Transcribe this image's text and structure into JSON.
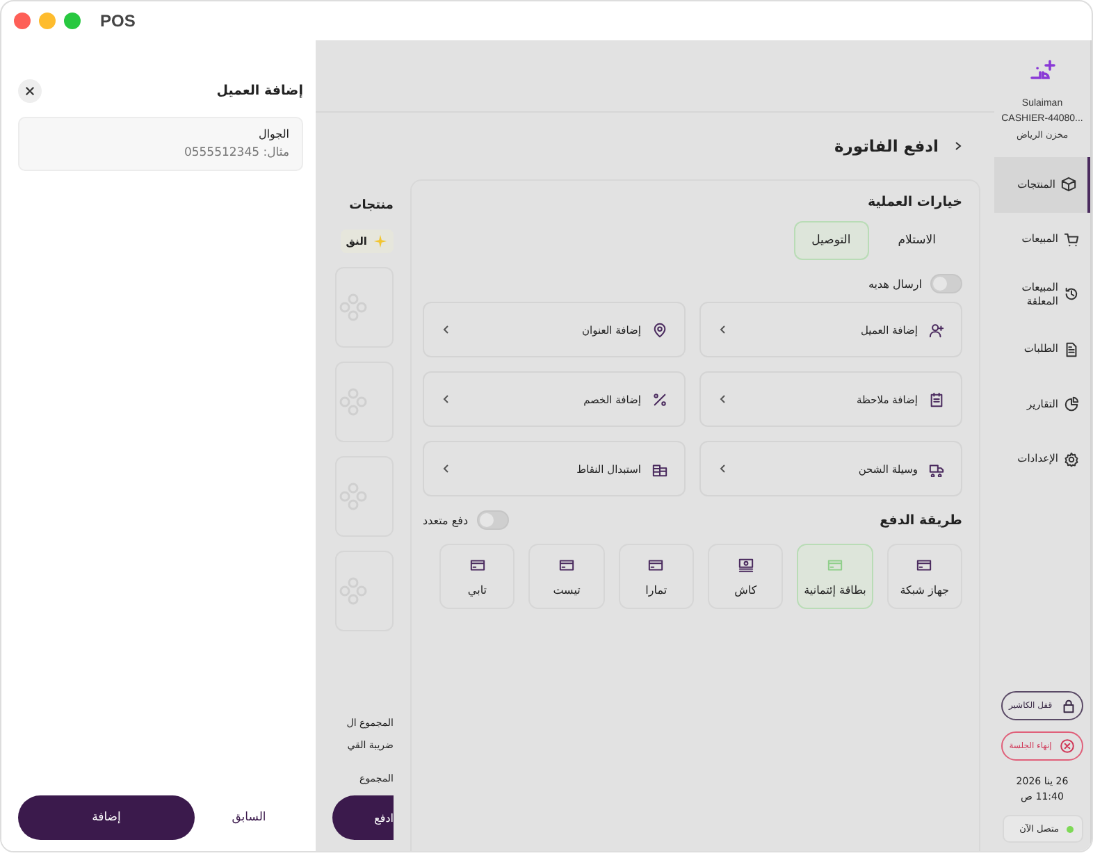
{
  "window": {
    "title": "POS"
  },
  "drawer": {
    "title": "إضافة العميل",
    "field": {
      "label": "الجوال",
      "placeholder": "مثال: 0555512345"
    },
    "buttons": [
      {
        "label": "السابق",
        "kind": "text"
      },
      {
        "label": "إضافة",
        "kind": "primary"
      }
    ]
  },
  "sidebar": {
    "user": "Sulaiman",
    "register": "CASHIER-44080...",
    "store": "مخزن الرياض",
    "items": [
      {
        "label": "المنتجات",
        "kind": "box",
        "selected": true
      },
      {
        "label": "المبيعات",
        "kind": "cart",
        "selected": false
      },
      {
        "label": "المبيعات المعلقة",
        "kind": "history",
        "selected": false
      },
      {
        "label": "الطلبات",
        "kind": "doc",
        "selected": false
      },
      {
        "label": "التقارير",
        "kind": "chart",
        "selected": false
      },
      {
        "label": "الإعدادات",
        "kind": "gear",
        "selected": false
      }
    ],
    "actions": [
      {
        "label": "قفل الكاشير",
        "kind": "lock"
      },
      {
        "label": "إنهاء الجلسة",
        "kind": "end"
      }
    ],
    "date": "26 ينا 2026",
    "time": "11:40 ص",
    "status": {
      "label": "متصل الآن",
      "color": "#7ed957"
    }
  },
  "page": {
    "title": "ادفع الفاتورة"
  },
  "cart": {
    "title": "منتجات",
    "badge": "النق",
    "totals": [
      {
        "label": "المجموع ال",
        "kind": "line"
      },
      {
        "label": "ضريبة القي",
        "kind": "line"
      },
      {
        "label": "المجموع",
        "kind": "grand"
      }
    ],
    "pay_button": "ادفع"
  },
  "operation": {
    "title": "خيارات العملية",
    "tabs": [
      {
        "label": "الاستلام",
        "selected": false
      },
      {
        "label": "التوصيل",
        "selected": true
      }
    ],
    "gift_toggle": {
      "label": "ارسال هديه",
      "on": false
    },
    "options": [
      {
        "label": "إضافة العميل",
        "kind": "user-plus"
      },
      {
        "label": "إضافة العنوان",
        "kind": "pin"
      },
      {
        "label": "إضافة ملاحظة",
        "kind": "note"
      },
      {
        "label": "إضافة الخصم",
        "kind": "percent"
      },
      {
        "label": "وسيلة الشحن",
        "kind": "truck"
      },
      {
        "label": "استبدال النقاط",
        "kind": "coins"
      }
    ]
  },
  "payment": {
    "title": "طريقة الدفع",
    "multi_toggle": {
      "label": "دفع متعدد",
      "on": false
    },
    "methods": [
      {
        "label": "جهاز شبكة",
        "kind": "card",
        "selected": false
      },
      {
        "label": "بطاقة إئتمانية",
        "kind": "card",
        "selected": true
      },
      {
        "label": "كاش",
        "kind": "cash",
        "selected": false
      },
      {
        "label": "تمارا",
        "kind": "card",
        "selected": false
      },
      {
        "label": "تيست",
        "kind": "card",
        "selected": false
      },
      {
        "label": "تابي",
        "kind": "card",
        "selected": false
      }
    ]
  }
}
